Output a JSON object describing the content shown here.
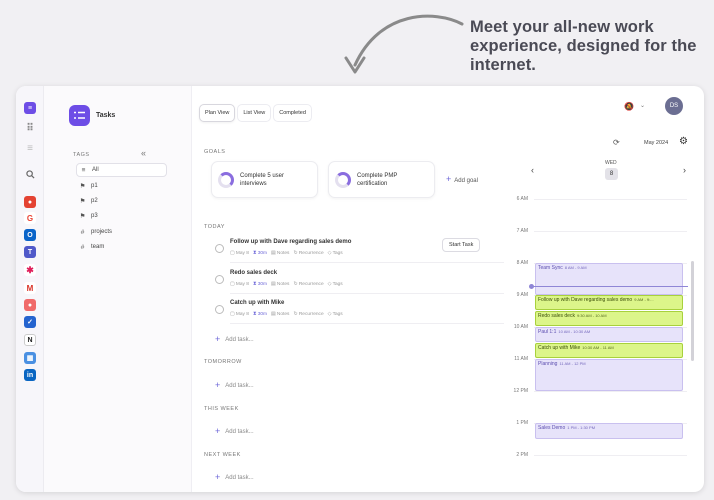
{
  "headline": [
    "Meet your all-new work",
    "experience, designed for the",
    "internet."
  ],
  "app": {
    "name": "Tasks"
  },
  "sidebar": {
    "tags_header": "TAGS",
    "items": [
      {
        "icon": "≡",
        "label": "All"
      },
      {
        "icon": "⚑",
        "label": "p1"
      },
      {
        "icon": "⚑",
        "label": "p2"
      },
      {
        "icon": "⚑",
        "label": "p3"
      },
      {
        "icon": "#",
        "label": "projects"
      },
      {
        "icon": "#",
        "label": "team"
      }
    ]
  },
  "tabs": [
    "Plan View",
    "List View",
    "Completed"
  ],
  "sections": {
    "goals": "GOALS",
    "today": "TODAY",
    "tomorrow": "TOMORROW",
    "this_week": "THIS WEEK",
    "next_week": "NEXT WEEK"
  },
  "goals": [
    {
      "line1": "Complete 5 user",
      "line2": "interviews"
    },
    {
      "line1": "Complete PMP",
      "line2": "certification"
    }
  ],
  "add_goal": "Add goal",
  "tasks": [
    {
      "title": "Follow up with Dave regarding sales demo",
      "date": "May 8",
      "duration": "30m",
      "notes": "Notes",
      "recurrence": "Recurrence",
      "tags": "Tags"
    },
    {
      "title": "Redo sales deck",
      "date": "May 8",
      "duration": "30m",
      "notes": "Notes",
      "recurrence": "Recurrence",
      "tags": "Tags"
    },
    {
      "title": "Catch up with Mike",
      "date": "May 8",
      "duration": "30m",
      "notes": "Notes",
      "recurrence": "Recurrence",
      "tags": "Tags"
    }
  ],
  "start_task": "Start Task",
  "add_task": "Add task...",
  "avatar": "DS",
  "calendar": {
    "month": "May 2024",
    "day_name": "WED",
    "day_num": "8",
    "hours": [
      "6 AM",
      "7 AM",
      "8 AM",
      "9 AM",
      "10 AM",
      "11 AM",
      "12 PM",
      "1 PM",
      "2 PM"
    ],
    "events": [
      {
        "title": "Team Sync",
        "time": "8 AM - 9 AM",
        "color": "purple"
      },
      {
        "title": "Follow up with Dave regarding sales demo",
        "time": "9 AM - 9:...",
        "color": "green"
      },
      {
        "title": "Redo sales deck",
        "time": "9:30 AM - 10 AM",
        "color": "green"
      },
      {
        "title": "Paul 1:1",
        "time": "10 AM - 10:30 AM",
        "color": "purple"
      },
      {
        "title": "Catch up with Mike",
        "time": "10:30 AM - 11 AM",
        "color": "green"
      },
      {
        "title": "Planning",
        "time": "11 AM - 12 PM",
        "color": "purple"
      },
      {
        "title": "Sales Demo",
        "time": "1 PM - 1:30 PM",
        "color": "purple"
      }
    ]
  },
  "colors": {
    "accent": "#6d4de6",
    "event_purple": "#e7e3fa",
    "event_green": "#dcf58a"
  }
}
